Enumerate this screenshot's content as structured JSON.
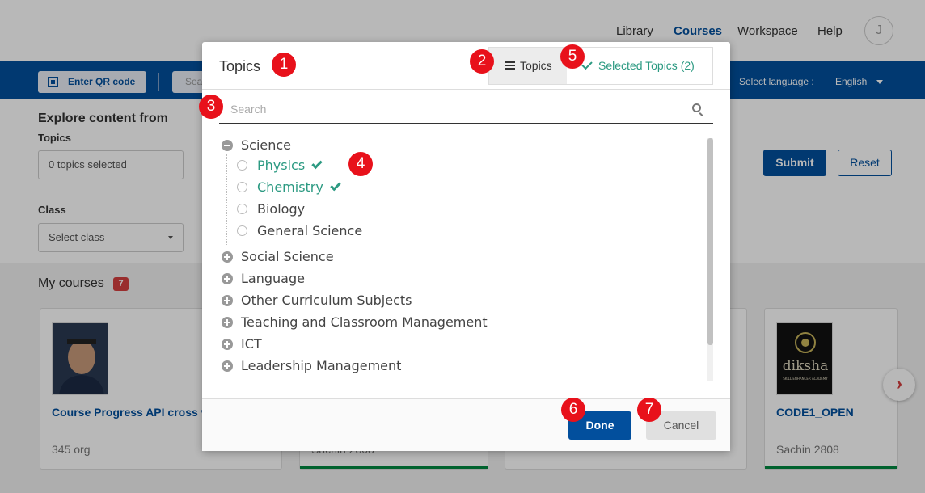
{
  "top_nav": {
    "items": [
      "Library",
      "Courses",
      "Workspace",
      "Help"
    ],
    "avatar_initial": "J"
  },
  "blue_bar": {
    "qr_label": "Enter QR code",
    "search_stub": "Sea",
    "language_label": "Select language :",
    "language_value": "English"
  },
  "explore": {
    "title": "Explore content from",
    "topics_label": "Topics",
    "topics_value": "0 topics selected",
    "class_label": "Class",
    "class_value": "Select class",
    "submit_label": "Submit",
    "reset_label": "Reset"
  },
  "my_courses": {
    "title": "My courses",
    "count": "7",
    "cards": [
      {
        "title": "Course Progress API cross v",
        "meta": "345 org"
      },
      {
        "title": "",
        "meta": "Sachin 2808"
      },
      {
        "title": "",
        "meta": ""
      },
      {
        "title": "CODE1_OPEN",
        "meta": "Sachin 2808",
        "thumb_text": "diksha",
        "thumb_subtext": "SKILL ENHANCER ACADEMY"
      }
    ]
  },
  "modal": {
    "title": "Topics",
    "tab_topics": "Topics",
    "tab_selected": "Selected Topics (2)",
    "search_placeholder": "Search",
    "tree": [
      {
        "label": "Science",
        "expanded": true,
        "children": [
          {
            "label": "Physics",
            "selected": true
          },
          {
            "label": "Chemistry",
            "selected": true
          },
          {
            "label": "Biology",
            "selected": false
          },
          {
            "label": "General Science",
            "selected": false
          }
        ]
      },
      {
        "label": "Social Science",
        "expanded": false
      },
      {
        "label": "Language",
        "expanded": false
      },
      {
        "label": "Other Curriculum Subjects",
        "expanded": false
      },
      {
        "label": "Teaching and Classroom Management",
        "expanded": false
      },
      {
        "label": "ICT",
        "expanded": false
      },
      {
        "label": "Leadership Management",
        "expanded": false
      }
    ],
    "done_label": "Done",
    "cancel_label": "Cancel"
  },
  "markers": [
    "1",
    "2",
    "3",
    "4",
    "5",
    "6",
    "7"
  ],
  "colors": {
    "primary": "#024f9d",
    "selected_green": "#2c9a82",
    "marker_red": "#e8111b",
    "badge_red": "#d43f3f",
    "progress_green": "#008840"
  }
}
